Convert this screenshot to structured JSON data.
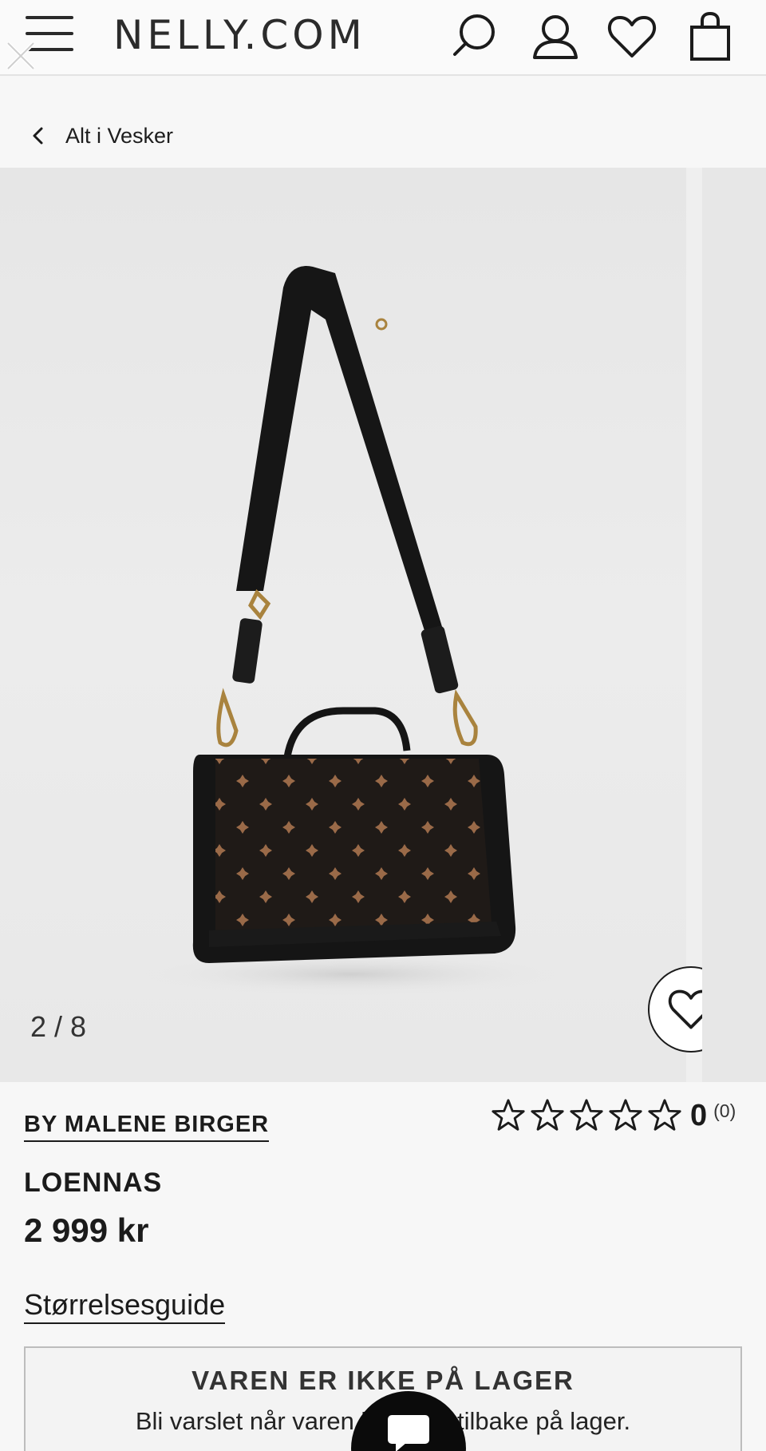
{
  "header": {
    "logo": "NELLY.COM",
    "icons": [
      "menu-icon",
      "close-icon",
      "search-icon",
      "account-icon",
      "wishlist-icon",
      "cart-icon"
    ]
  },
  "breadcrumb": {
    "label": "Alt i Vesker"
  },
  "gallery": {
    "counter": "2 / 8",
    "current": 2,
    "total": 8
  },
  "product": {
    "brand": "BY MALENE BIRGER",
    "name": "LOENNAS",
    "price": "2 999 kr",
    "rating_value": "0",
    "rating_count": "(0)",
    "stars_max": 5
  },
  "size_guide": {
    "label": "Størrelsesguide"
  },
  "stock": {
    "title": "VAREN ER IKKE PÅ LAGER",
    "subtitle": "Bli varslet når varen kommer tilbake på lager.",
    "subtitle_visible_left": "Bli varslet når v",
    "subtitle_visible_right": "es på lager."
  },
  "colors": {
    "text": "#1b1b1b",
    "bag_body": "#1f1a17",
    "bag_pattern": "#9a6a48",
    "hardware": "#a9833e"
  }
}
